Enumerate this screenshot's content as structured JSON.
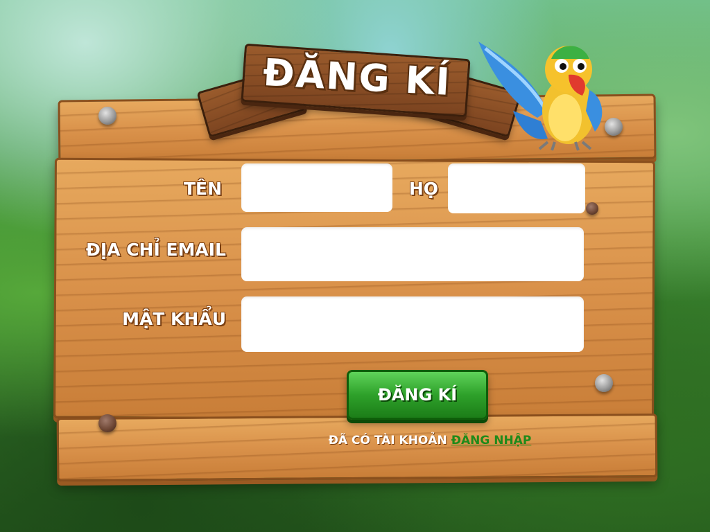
{
  "title": "ĐĂNG KÍ",
  "form": {
    "first_name_label": "TÊN",
    "last_name_label": "HỌ",
    "email_label": "ĐỊA CHỈ EMAIL",
    "password_label": "MẬT KHẨU",
    "first_name_value": "",
    "last_name_value": "",
    "email_value": "",
    "password_value": ""
  },
  "submit_label": "ĐĂNG KÍ",
  "footer": {
    "prompt": "ĐÃ CÓ TÀI KHOẢN",
    "login_link": "ĐĂNG NHẬP"
  },
  "icons": [
    "parrot-mascot-icon",
    "nail-icon"
  ],
  "colors": {
    "wood": "#d9914a",
    "wood_dark": "#8a4f1d",
    "button_green": "#2ea12a",
    "link_green": "#1f8a1a"
  }
}
